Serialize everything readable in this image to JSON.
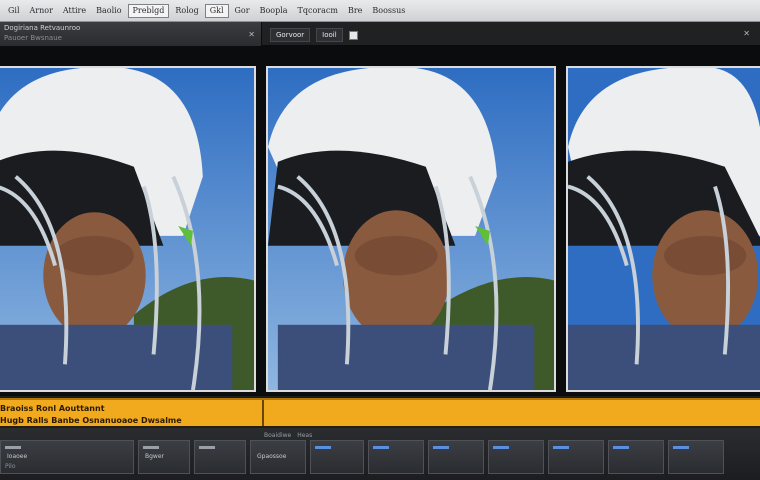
{
  "menubar": {
    "items": [
      "Gil",
      "Arnor",
      "Attire",
      "Baolio",
      "Preblgd",
      "Rolog",
      "Gkl",
      "Gor",
      "Boopla",
      "Tqcoracm",
      "Bre",
      "Boossus"
    ],
    "boxed_indexes": [
      4,
      6
    ]
  },
  "left_panel": {
    "tab_label": "Dogiriana Retvaunroo",
    "tab_sublabel": "Pauoer Bwsnaue",
    "close_glyph": "✕"
  },
  "viewer_tabs": {
    "tab_label": "Gorvoor",
    "tab_suffix": "Iooil"
  },
  "right_close_glyph": "✕",
  "orange_band": {
    "line1": "Braoiss Ronl Aouttannt",
    "line2": "Hugb Ralls Banbe Osnanuoaoe Dwsalme"
  },
  "bottom": {
    "ruler_labels": [
      "Boaidiwe",
      "Heas",
      "",
      "",
      "",
      "",
      "",
      "",
      ""
    ],
    "cells": [
      {
        "label": "Ioaoee",
        "sub": "Pilo"
      },
      {
        "label": "Bgwer",
        "sub": ""
      },
      {
        "label": "",
        "sub": ""
      },
      {
        "label": "Gpaossoe",
        "sub": ""
      },
      {
        "label": "",
        "sub": ""
      },
      {
        "label": "",
        "sub": ""
      },
      {
        "label": "",
        "sub": ""
      },
      {
        "label": "",
        "sub": ""
      },
      {
        "label": "",
        "sub": ""
      },
      {
        "label": "",
        "sub": ""
      },
      {
        "label": "",
        "sub": ""
      },
      {
        "label": "",
        "sub": ""
      }
    ]
  },
  "colors": {
    "accent_orange": "#f1a91d",
    "sky": "#3b78c8",
    "helmet": "#eceef0",
    "hill": "#3f5a2a"
  }
}
